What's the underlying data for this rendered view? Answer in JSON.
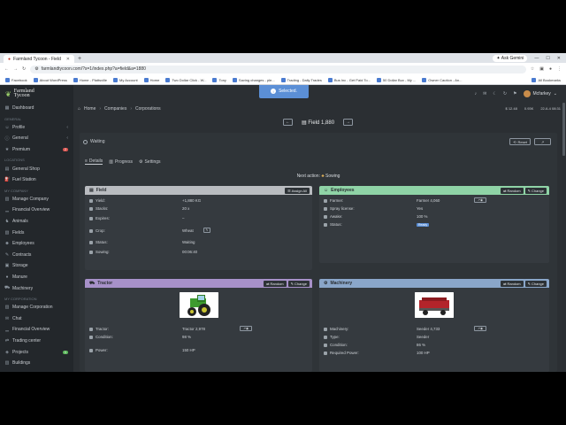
{
  "browser": {
    "tab_title": "Farmland Tycoon - Field",
    "new_tab": "+",
    "ask_gemini": "Ask Gemini",
    "url": "farmlandtycoon.com/?s=1/index.php?a=field&a=1880",
    "bookmarks": [
      "Facebook",
      "About WordPress",
      "Home - Plattsville",
      "My Account",
      "Home",
      "Two Dollar Click - W...",
      "Tony",
      "Saving changes - ple...",
      "Trading - Daily Trades",
      "Bus Inc - Get Paid To...",
      "50 Dollar Bux - My ...",
      "Owner Caution - An..."
    ],
    "all_bookmarks": "All Bookmarks"
  },
  "app": {
    "logo_line1": "Farmland",
    "logo_line2": "Tycoon",
    "toast": "Selected.",
    "user_name": "Mcfarkey",
    "resources": [
      "$ 12.48",
      "0.93K",
      "22-6-4 08:31"
    ],
    "breadcrumb": [
      "Home",
      "Companies",
      "Corporations"
    ]
  },
  "sidebar": {
    "sections": [
      {
        "title": "",
        "items": [
          {
            "label": "Dashboard",
            "icon": "dashboard-icon"
          }
        ]
      },
      {
        "title": "General",
        "items": [
          {
            "label": "Profile",
            "icon": "user-icon",
            "chevron": true
          },
          {
            "label": "General",
            "icon": "info-icon",
            "chevron": true
          },
          {
            "label": "Premium",
            "icon": "star-icon",
            "badge": "2"
          }
        ]
      },
      {
        "title": "Locations",
        "items": [
          {
            "label": "General Shop",
            "icon": "shop-icon"
          },
          {
            "label": "Fuel Station",
            "icon": "fuel-icon"
          }
        ]
      },
      {
        "title": "My Company",
        "items": [
          {
            "label": "Manage Company",
            "icon": "building-icon"
          },
          {
            "label": "Financial Overview",
            "icon": "chart-icon"
          },
          {
            "label": "Animals",
            "icon": "animal-icon"
          },
          {
            "label": "Fields",
            "icon": "field-icon"
          },
          {
            "label": "Employees",
            "icon": "people-icon"
          },
          {
            "label": "Contracts",
            "icon": "contract-icon"
          },
          {
            "label": "Storage",
            "icon": "storage-icon"
          },
          {
            "label": "Manure",
            "icon": "manure-icon"
          },
          {
            "label": "Machinery",
            "icon": "tractor-icon"
          }
        ]
      },
      {
        "title": "My Corporation",
        "items": [
          {
            "label": "Manage Corporation",
            "icon": "building-icon"
          },
          {
            "label": "Chat",
            "icon": "chat-icon"
          },
          {
            "label": "Financial Overview",
            "icon": "chart-icon"
          },
          {
            "label": "Trading center",
            "icon": "trade-icon"
          },
          {
            "label": "Projects",
            "icon": "project-icon",
            "badge": "1",
            "badge_color": "green"
          },
          {
            "label": "Buildings",
            "icon": "building-icon"
          }
        ]
      }
    ]
  },
  "field_header": {
    "title": "Field 1,880",
    "prev": "←",
    "next": "→"
  },
  "status": {
    "label": "Waiting",
    "reset": "Reset"
  },
  "subtabs": [
    "Details",
    "Progress",
    "Settings"
  ],
  "next_action": {
    "label": "Next action:",
    "value": "Sowing"
  },
  "field_card": {
    "title": "Field",
    "assign_all": "Assign All",
    "rows": [
      {
        "k": "Yield:",
        "v": "+1,880 KG"
      },
      {
        "k": "Stacks:",
        "v": "20 x"
      },
      {
        "k": "Expires:",
        "v": "–"
      },
      {
        "k": "Crop:",
        "v": "Wheat"
      },
      {
        "k": "Status:",
        "v": "Waiting"
      },
      {
        "k": "Sowing:",
        "v": "00:06:40"
      }
    ]
  },
  "employees_card": {
    "title": "Employees",
    "random": "Random",
    "change": "Change",
    "rows": [
      {
        "k": "Farmer:",
        "v": "Farmer 4,060"
      },
      {
        "k": "Spray license:",
        "v": "Yes"
      },
      {
        "k": "Awake:",
        "v": "100 %"
      },
      {
        "k": "Status:",
        "v": "Ready"
      }
    ]
  },
  "tractor_card": {
    "title": "Tractor",
    "random": "Random",
    "change": "Change",
    "rows": [
      {
        "k": "Tractor:",
        "v": "Tractor 2,978"
      },
      {
        "k": "Condition:",
        "v": "98 %"
      },
      {
        "k": "Power:",
        "v": "150 HP"
      }
    ]
  },
  "machinery_card": {
    "title": "Machinery",
    "random": "Random",
    "change": "Change",
    "rows": [
      {
        "k": "Machinery:",
        "v": "Seeder 4,733"
      },
      {
        "k": "Type:",
        "v": "Seeder"
      },
      {
        "k": "Condition:",
        "v": "86 %"
      },
      {
        "k": "Required Power:",
        "v": "100 HP"
      }
    ]
  },
  "colors": {
    "field_head": "#b9bcc0",
    "employees_head": "#8fd3a6",
    "tractor_head": "#a791c9",
    "machinery_head": "#8aa6c9",
    "accent": "#5b8fd6"
  }
}
